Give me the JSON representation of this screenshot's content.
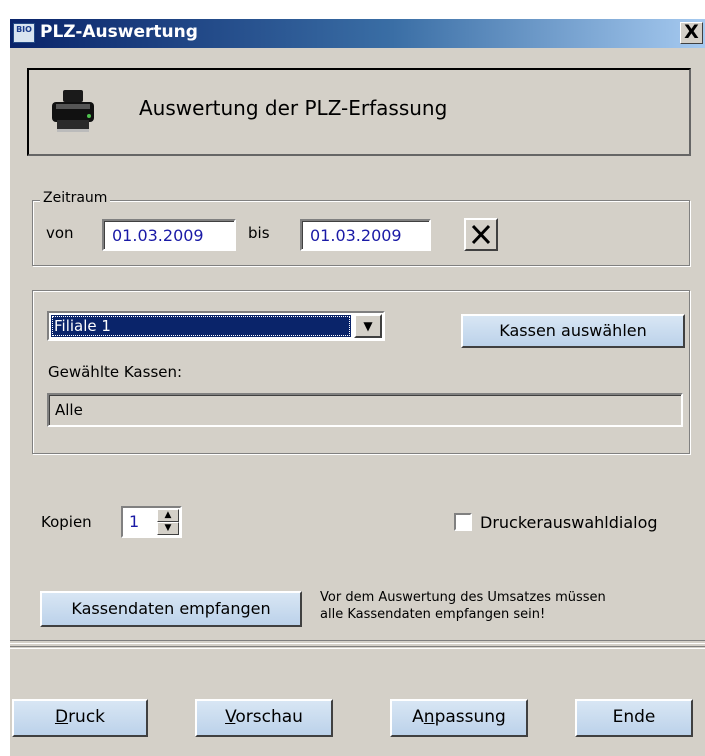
{
  "window": {
    "title": "PLZ-Auswertung",
    "icon_text": "BIO",
    "close_label": "X"
  },
  "header": {
    "text": "Auswertung der PLZ-Erfassung",
    "icon": "printer-icon"
  },
  "zeitraum": {
    "legend": "Zeitraum",
    "von_label": "von",
    "von_value": "01.03.2009",
    "bis_label": "bis",
    "bis_value": "01.03.2009",
    "clear_label": "X"
  },
  "filiale": {
    "selected": "Filiale 1",
    "kassen_button": "Kassen auswählen",
    "gewaehlte_label": "Gewählte Kassen:",
    "gewaehlte_value": "Alle"
  },
  "kopien": {
    "label": "Kopien",
    "value": "1"
  },
  "drucker": {
    "label": "Druckerauswahldialog",
    "checked": false
  },
  "empfangen": {
    "button": "Kassendaten empfangen",
    "note_line1": "Vor dem Auswertung des Umsatzes müssen",
    "note_line2": "alle Kassendaten empfangen sein!"
  },
  "buttons": {
    "druck": {
      "pre": "",
      "acc": "D",
      "post": "ruck"
    },
    "vorschau": {
      "pre": "",
      "acc": "V",
      "post": "orschau"
    },
    "anpassung": {
      "pre": "A",
      "acc": "n",
      "post": "passung"
    },
    "ende": {
      "pre": "Ende",
      "acc": "",
      "post": ""
    }
  },
  "colors": {
    "titlebar_start": "#0a246a",
    "face": "#d4d0c8",
    "input_text": "#1a1aa6",
    "button_face": "#c8dcf0"
  }
}
